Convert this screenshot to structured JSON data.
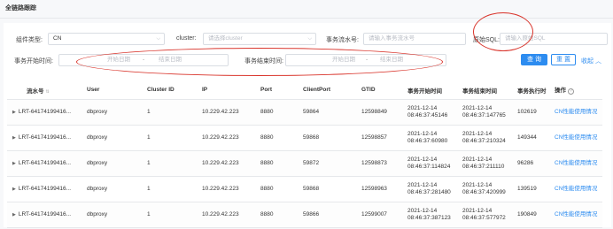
{
  "page": {
    "title": "全链路跟踪"
  },
  "filters": {
    "component_type": {
      "label": "组件类型:",
      "value": "CN"
    },
    "cluster": {
      "label": "cluster:",
      "placeholder": "请选择cluster"
    },
    "txn_id": {
      "label": "事务流水号:",
      "placeholder": "请输入事务流水号"
    },
    "sql": {
      "label": "原始SQL:",
      "placeholder": "请输入原始SQL"
    },
    "start_time": {
      "label": "事务开始时间:",
      "from_placeholder": "开始日期",
      "to_placeholder": "结束日期",
      "separator": "-"
    },
    "end_time": {
      "label": "事务结束时间:",
      "from_placeholder": "开始日期",
      "to_placeholder": "结束日期",
      "separator": "-"
    },
    "query_button": "查 询",
    "reset_button": "重 置",
    "collapse_link": "收起 ︿"
  },
  "table": {
    "columns": [
      "流水号",
      "User",
      "Cluster ID",
      "IP",
      "Port",
      "ClientPort",
      "GTID",
      "事务开始时间",
      "事务结束时间",
      "事务执行时",
      "操作"
    ],
    "rows": [
      {
        "txn": "LRT-64174199416...",
        "user": "dbproxy",
        "cluster_id": "1",
        "ip": "10.229.42.223",
        "port": "8880",
        "client_port": "59864",
        "gtid": "12598849",
        "start_date": "2021-12-14",
        "start_time": "08:46:37:45146",
        "end_date": "2021-12-14",
        "end_time": "08:46:37:147765",
        "duration": "102619",
        "op": "CN性能使用情况"
      },
      {
        "txn": "LRT-64174199416...",
        "user": "dbproxy",
        "cluster_id": "1",
        "ip": "10.229.42.223",
        "port": "8880",
        "client_port": "59868",
        "gtid": "12598857",
        "start_date": "2021-12-14",
        "start_time": "08:46:37:60980",
        "end_date": "2021-12-14",
        "end_time": "08:46:37:210324",
        "duration": "149344",
        "op": "CN性能使用情况"
      },
      {
        "txn": "LRT-64174199416...",
        "user": "dbproxy",
        "cluster_id": "1",
        "ip": "10.229.42.223",
        "port": "8880",
        "client_port": "59872",
        "gtid": "12598873",
        "start_date": "2021-12-14",
        "start_time": "08:46:37:114824",
        "end_date": "2021-12-14",
        "end_time": "08:46:37:211110",
        "duration": "96286",
        "op": "CN性能使用情况"
      },
      {
        "txn": "LRT-64174199416...",
        "user": "dbproxy",
        "cluster_id": "1",
        "ip": "10.229.42.223",
        "port": "8880",
        "client_port": "59868",
        "gtid": "12598963",
        "start_date": "2021-12-14",
        "start_time": "08:46:37:281480",
        "end_date": "2021-12-14",
        "end_time": "08:46:37:420999",
        "duration": "139519",
        "op": "CN性能使用情况"
      },
      {
        "txn": "LRT-64174199416...",
        "user": "dbproxy",
        "cluster_id": "1",
        "ip": "10.229.42.223",
        "port": "8880",
        "client_port": "59866",
        "gtid": "12599007",
        "start_date": "2021-12-14",
        "start_time": "08:46:37:387123",
        "end_date": "2021-12-14",
        "end_time": "08:46:37:577972",
        "duration": "190849",
        "op": "CN性能使用情况"
      }
    ]
  },
  "colors": {
    "accent": "#2d8cf0",
    "annotation": "#d9342b"
  }
}
